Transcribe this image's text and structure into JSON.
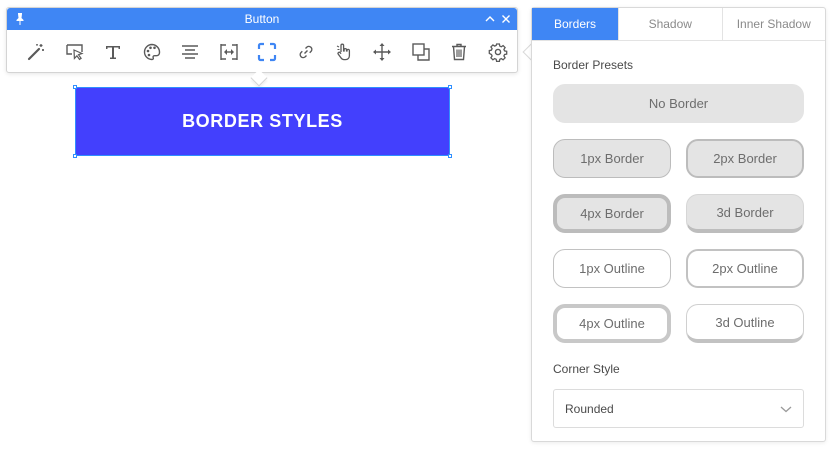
{
  "toolbar": {
    "title": "Button",
    "tools": [
      {
        "icon": "magic-wand-icon"
      },
      {
        "icon": "cursor-select-icon"
      },
      {
        "icon": "text-icon"
      },
      {
        "icon": "palette-icon"
      },
      {
        "icon": "align-center-icon"
      },
      {
        "icon": "width-resize-icon"
      },
      {
        "icon": "border-corners-icon",
        "active": true
      },
      {
        "icon": "link-icon"
      },
      {
        "icon": "hand-pointer-icon"
      },
      {
        "icon": "move-arrows-icon"
      },
      {
        "icon": "duplicate-icon"
      },
      {
        "icon": "trash-icon"
      },
      {
        "icon": "gear-icon"
      }
    ]
  },
  "canvas": {
    "button_label": "BORDER STYLES"
  },
  "panel": {
    "tabs": [
      {
        "label": "Borders",
        "active": true
      },
      {
        "label": "Shadow",
        "active": false
      },
      {
        "label": "Inner Shadow",
        "active": false
      }
    ],
    "presets_title": "Border Presets",
    "presets": {
      "no_border": "No Border",
      "border_1px": "1px Border",
      "border_2px": "2px Border",
      "border_4px": "4px Border",
      "border_3d": "3d Border",
      "outline_1px": "1px Outline",
      "outline_2px": "2px Outline",
      "outline_4px": "4px Outline",
      "outline_3d": "3d Outline"
    },
    "corner_title": "Corner Style",
    "corner_value": "Rounded"
  },
  "colors": {
    "accent": "#3f86f4",
    "button_fill": "#4340fd",
    "selection": "#2f8fff"
  }
}
